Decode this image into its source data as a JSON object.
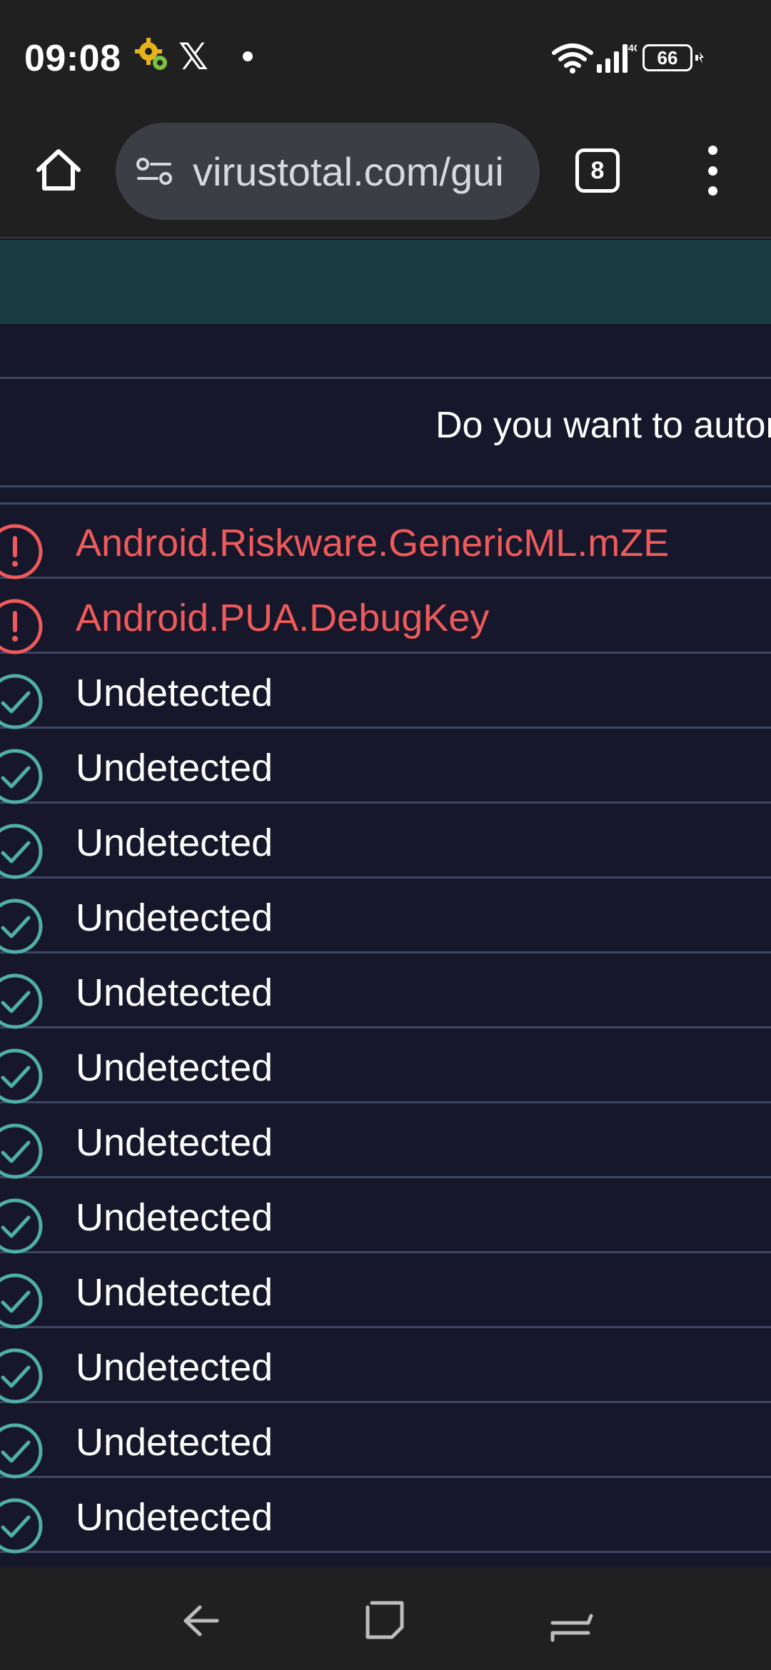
{
  "status_bar": {
    "time": "09:08",
    "x_glyph": "𝕏",
    "network": "4G",
    "battery": "66",
    "icons": [
      "gear-notification-icon",
      "x-app-icon",
      "wifi-icon",
      "signal-icon",
      "battery-icon"
    ]
  },
  "browser": {
    "url": "virustotal.com/gui",
    "tab_count": "8",
    "icons": [
      "home-icon",
      "site-settings-icon",
      "more-options-icon"
    ]
  },
  "page": {
    "prompt": "Do you want to automate checks?",
    "colors": {
      "banner": "#183c3f",
      "detected": "#ef5a5a",
      "clean": "#4fb0a8",
      "background": "#16172a"
    },
    "results": [
      {
        "label": "Android.Riskware.GenericML.mZE",
        "status": "detected"
      },
      {
        "label": "Android.PUA.DebugKey",
        "status": "detected"
      },
      {
        "label": "Undetected",
        "status": "clean"
      },
      {
        "label": "Undetected",
        "status": "clean"
      },
      {
        "label": "Undetected",
        "status": "clean"
      },
      {
        "label": "Undetected",
        "status": "clean"
      },
      {
        "label": "Undetected",
        "status": "clean"
      },
      {
        "label": "Undetected",
        "status": "clean"
      },
      {
        "label": "Undetected",
        "status": "clean"
      },
      {
        "label": "Undetected",
        "status": "clean"
      },
      {
        "label": "Undetected",
        "status": "clean"
      },
      {
        "label": "Undetected",
        "status": "clean"
      },
      {
        "label": "Undetected",
        "status": "clean"
      },
      {
        "label": "Undetected",
        "status": "clean"
      }
    ]
  },
  "nav_bar": {
    "icons": [
      "back-icon",
      "home-square-icon",
      "recents-icon"
    ]
  }
}
